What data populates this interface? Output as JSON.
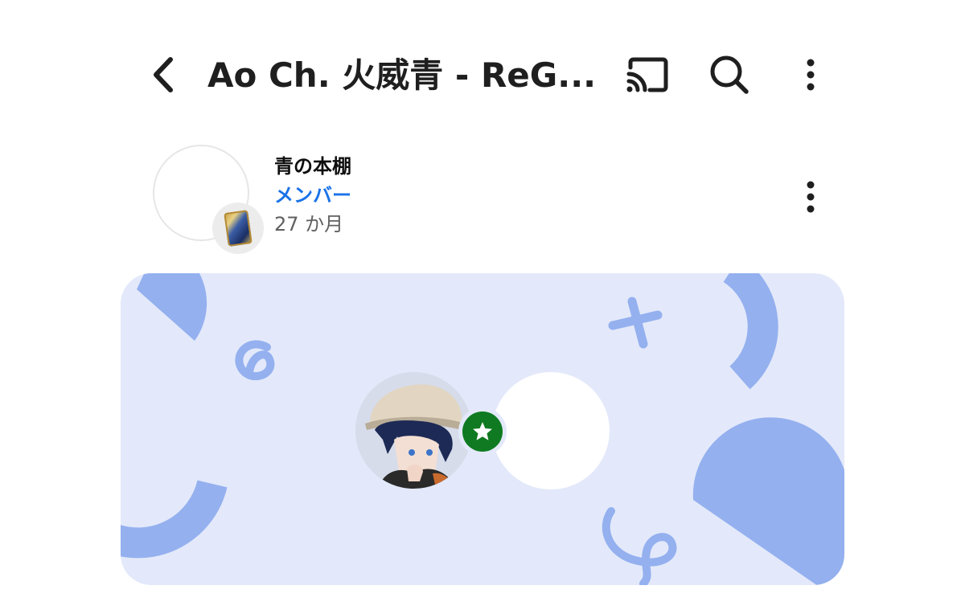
{
  "header": {
    "title": "Ao Ch. 火威青 - ReG...",
    "icons": {
      "back": "chevron-left-icon",
      "cast": "cast-icon",
      "search": "search-icon",
      "more": "more-vert-icon"
    }
  },
  "post": {
    "author": "青の本棚",
    "badge": "メンバー",
    "duration": "27 か月",
    "icons": {
      "badge_thumb": "book-icon",
      "more": "more-vert-icon",
      "star": "star-icon"
    }
  },
  "colors": {
    "member_blue": "#1a73e8",
    "banner_bg": "#e3e9fa",
    "banner_shapes": "#94b0ef",
    "star_green": "#0f7a21",
    "title_text": "#1f1f1f",
    "secondary_text": "#606060"
  }
}
